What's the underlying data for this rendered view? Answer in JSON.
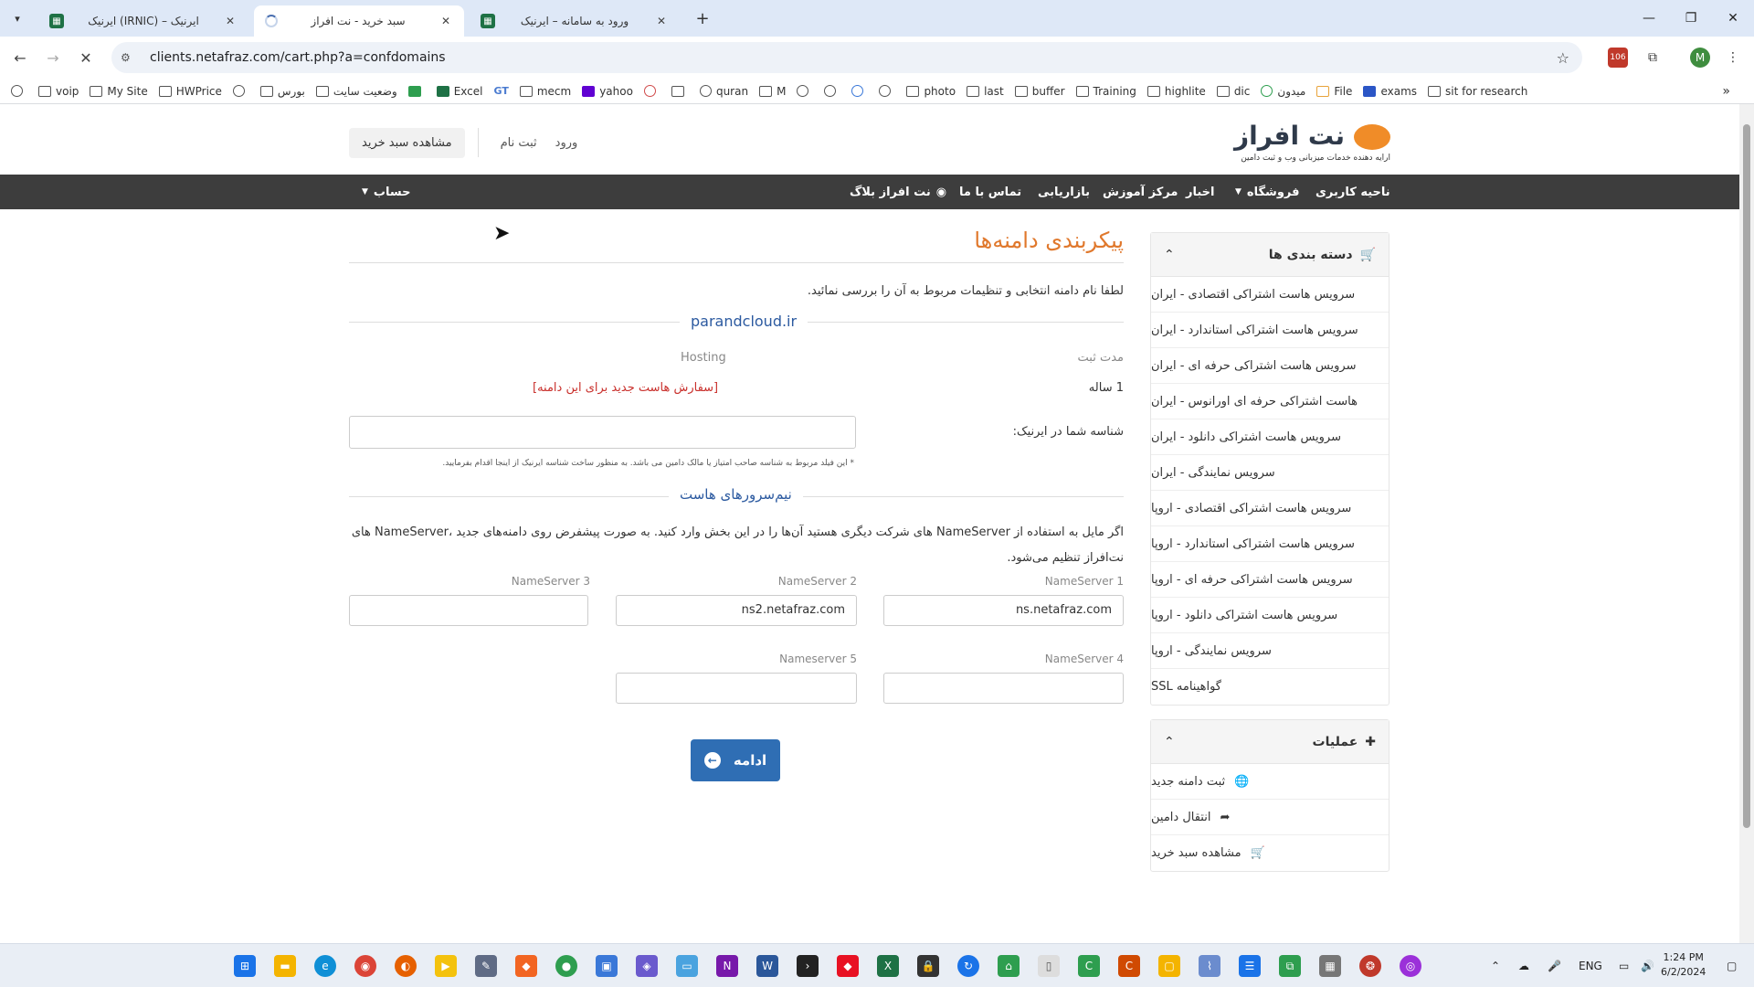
{
  "browser": {
    "tabs": [
      {
        "title": "ایرنیک (IRNIC) – ایرنیک",
        "active": false
      },
      {
        "title": "سبد خرید - نت افراز",
        "active": true,
        "loading": true
      },
      {
        "title": "ورود به سامانه – ایرنیک",
        "active": false
      }
    ],
    "url": "clients.netafraz.com/cart.php?a=confdomains",
    "profile_initial": "M",
    "extension_badge": "106",
    "bookmarks": [
      "voip",
      "My Site",
      "HWPrice",
      "",
      "بورس",
      "وضعیت سایت",
      "",
      "Excel",
      "GT",
      "mecm",
      "yahoo",
      "",
      "",
      "quran",
      "M",
      "",
      "",
      "",
      "",
      "photo",
      "last",
      "buffer",
      "Training",
      "highlite",
      "dic",
      "میدون",
      "File",
      "exams",
      "sit for research"
    ]
  },
  "header": {
    "brand": "نت افراز",
    "tagline": "ارایه دهنده خدمات میزبانی وب و ثبت دامین",
    "cart_button": "مشاهده سبد خرید",
    "register": "ثبت نام",
    "login": "ورود"
  },
  "nav": {
    "user_area": "ناحیه کاربری",
    "store": "فروشگاه",
    "news": "اخبار",
    "edu": "مرکز آموزش",
    "marketing": "بازاریابی",
    "contact": "تماس با ما",
    "blog": "نت افراز بلاگ",
    "account": "حساب"
  },
  "sidebar": {
    "categories_title": "دسته بندی ها",
    "categories": [
      "سرویس هاست اشتراکی اقتصادی - ایران",
      "سرویس هاست اشتراکی استاندارد - ایران",
      "سرویس هاست اشتراکی حرفه ای - ایران",
      "هاست اشتراکی حرفه ای اورانوس - ایران",
      "سرویس هاست اشتراکی دانلود - ایران",
      "سرویس نمایندگی - ایران",
      "سرویس هاست اشتراکی اقتصادی - اروپا",
      "سرویس هاست اشتراکی استاندارد - اروپا",
      "سرویس هاست اشتراکی حرفه ای - اروپا",
      "سرویس هاست اشتراکی دانلود - اروپا",
      "سرویس نمایندگی - اروپا",
      "گواهینامه SSL"
    ],
    "actions_title": "عملیات",
    "actions": [
      "ثبت دامنه جدید",
      "انتقال دامین",
      "مشاهده سبد خرید"
    ]
  },
  "main": {
    "title": "پیکربندی دامنه‌ها",
    "intro": "لطفا نام دامنه انتخابی و تنظیمات مربوط به آن را بررسی نمائید.",
    "domain": "parandcloud.ir",
    "reg_period_label": "مدت ثبت",
    "hosting_label": "Hosting",
    "reg_period_value": "1 ساله",
    "order_hosting_link": "[سفارش هاست جدید برای این دامنه]",
    "irnic_label": "شناسه شما در ایرنیک:",
    "irnic_value": "",
    "irnic_note": "* این فیلد مربوط به شناسه صاحب امتیاز یا مالک دامین می باشد. به منظور ساخت شناسه ایرنیک از اینجا اقدام بفرمایید.",
    "ns_title": "نیم‌سرورهای هاست",
    "ns_desc": "اگر مایل به استفاده از NameServer های شرکت دیگری هستید آن‌ها را در این بخش وارد کنید. به صورت پیشفرض روی دامنه‌های جدید ،NameServer های نت‌افراز تنظیم می‌شود.",
    "ns1_label": "NameServer 1",
    "ns2_label": "NameServer 2",
    "ns3_label": "NameServer 3",
    "ns4_label": "NameServer 4",
    "ns5_label": "Nameserver 5",
    "ns1": "ns.netafraz.com",
    "ns2": "ns2.netafraz.com",
    "ns3": "",
    "ns4": "",
    "ns5": "",
    "continue": "ادامه"
  },
  "taskbar": {
    "lang": "ENG",
    "time": "1:24 PM",
    "date": "6/2/2024"
  }
}
